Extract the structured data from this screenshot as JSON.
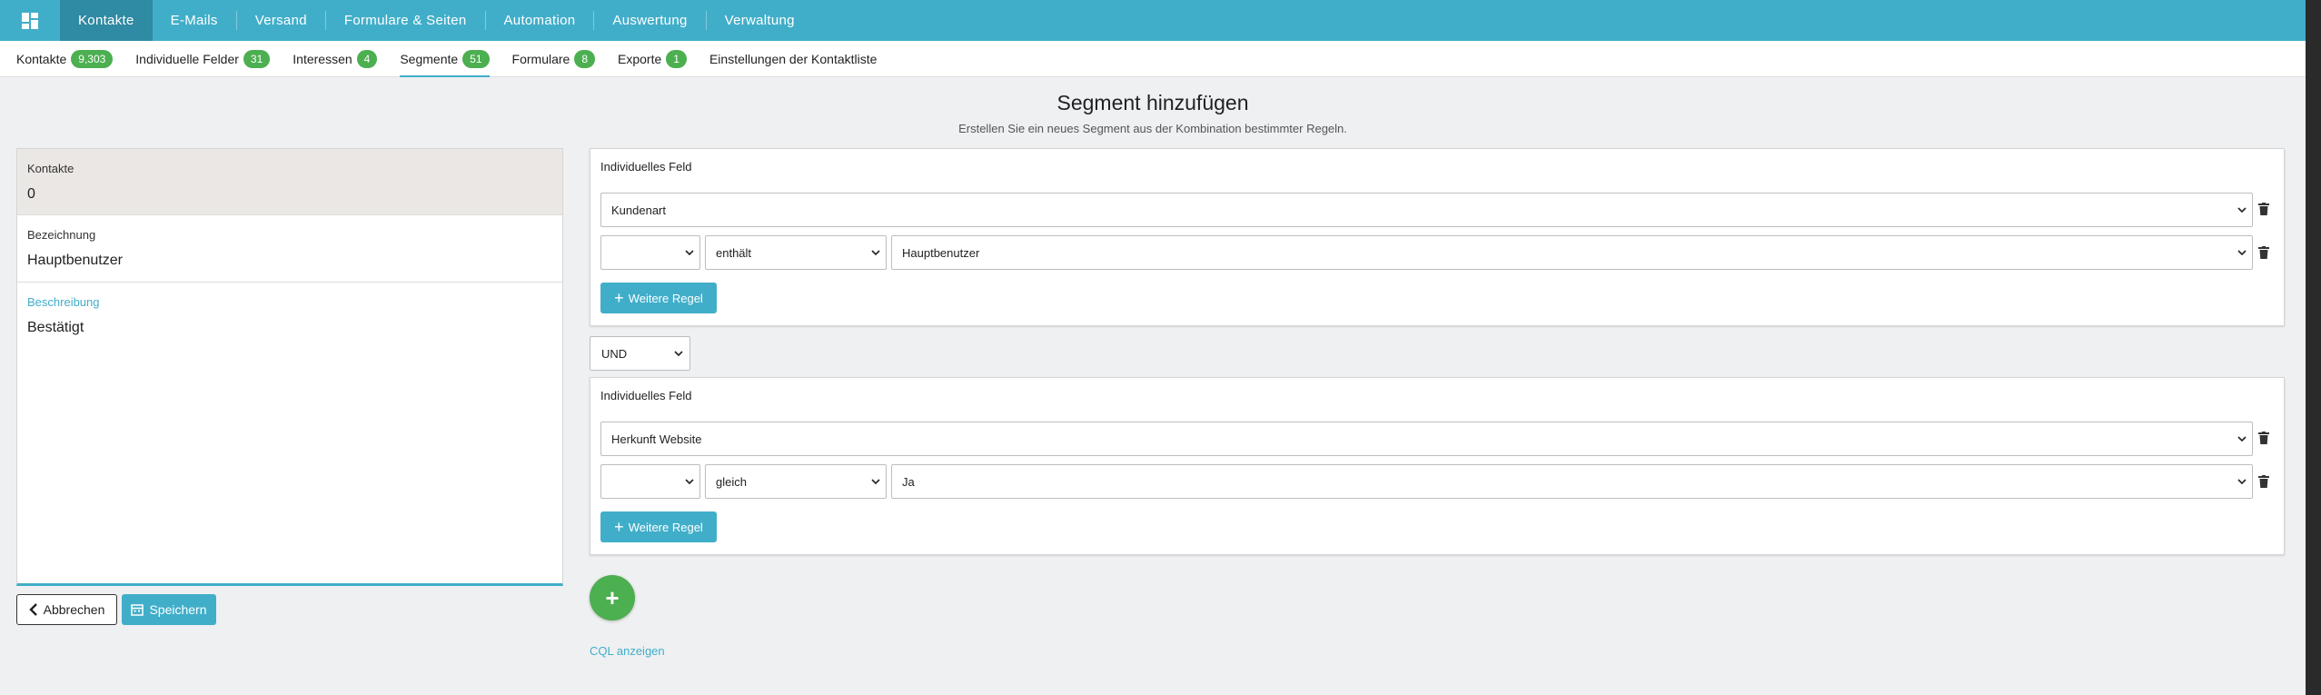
{
  "topnav": {
    "items": [
      {
        "label": "Kontakte",
        "active": true
      },
      {
        "label": "E-Mails"
      },
      {
        "label": "Versand"
      },
      {
        "label": "Formulare & Seiten"
      },
      {
        "label": "Automation"
      },
      {
        "label": "Auswertung"
      },
      {
        "label": "Verwaltung"
      }
    ]
  },
  "subnav": {
    "items": [
      {
        "label": "Kontakte",
        "badge": "9,303"
      },
      {
        "label": "Individuelle Felder",
        "badge": "31"
      },
      {
        "label": "Interessen",
        "badge": "4"
      },
      {
        "label": "Segmente",
        "badge": "51",
        "active": true
      },
      {
        "label": "Formulare",
        "badge": "8"
      },
      {
        "label": "Exporte",
        "badge": "1"
      },
      {
        "label": "Einstellungen der Kontaktliste"
      }
    ]
  },
  "header": {
    "title": "Segment hinzufügen",
    "subtitle": "Erstellen Sie ein neues Segment aus der Kombination bestimmter Regeln."
  },
  "left_panel": {
    "contacts_label": "Kontakte",
    "contacts_value": "0",
    "name_label": "Bezeichnung",
    "name_value": "Hauptbenutzer",
    "description_label": "Beschreibung",
    "description_value": "Bestätigt"
  },
  "buttons": {
    "cancel": "Abbrechen",
    "save": "Speichern",
    "more_rule": "Weitere Regel",
    "show_cql": "CQL anzeigen",
    "add": "+"
  },
  "groups": [
    {
      "title": "Individuelles Feld",
      "field": "Kundenart",
      "rule": {
        "prefix": "",
        "operator": "enthält",
        "value": "Hauptbenutzer"
      }
    },
    {
      "title": "Individuelles Feld",
      "field": "Herkunft Website",
      "rule": {
        "prefix": "",
        "operator": "gleich",
        "value": "Ja"
      }
    }
  ],
  "combinator": "UND",
  "colors": {
    "accent": "#41aec9",
    "accent_dark": "#2f8aa3",
    "badge_green": "#4caf50"
  }
}
